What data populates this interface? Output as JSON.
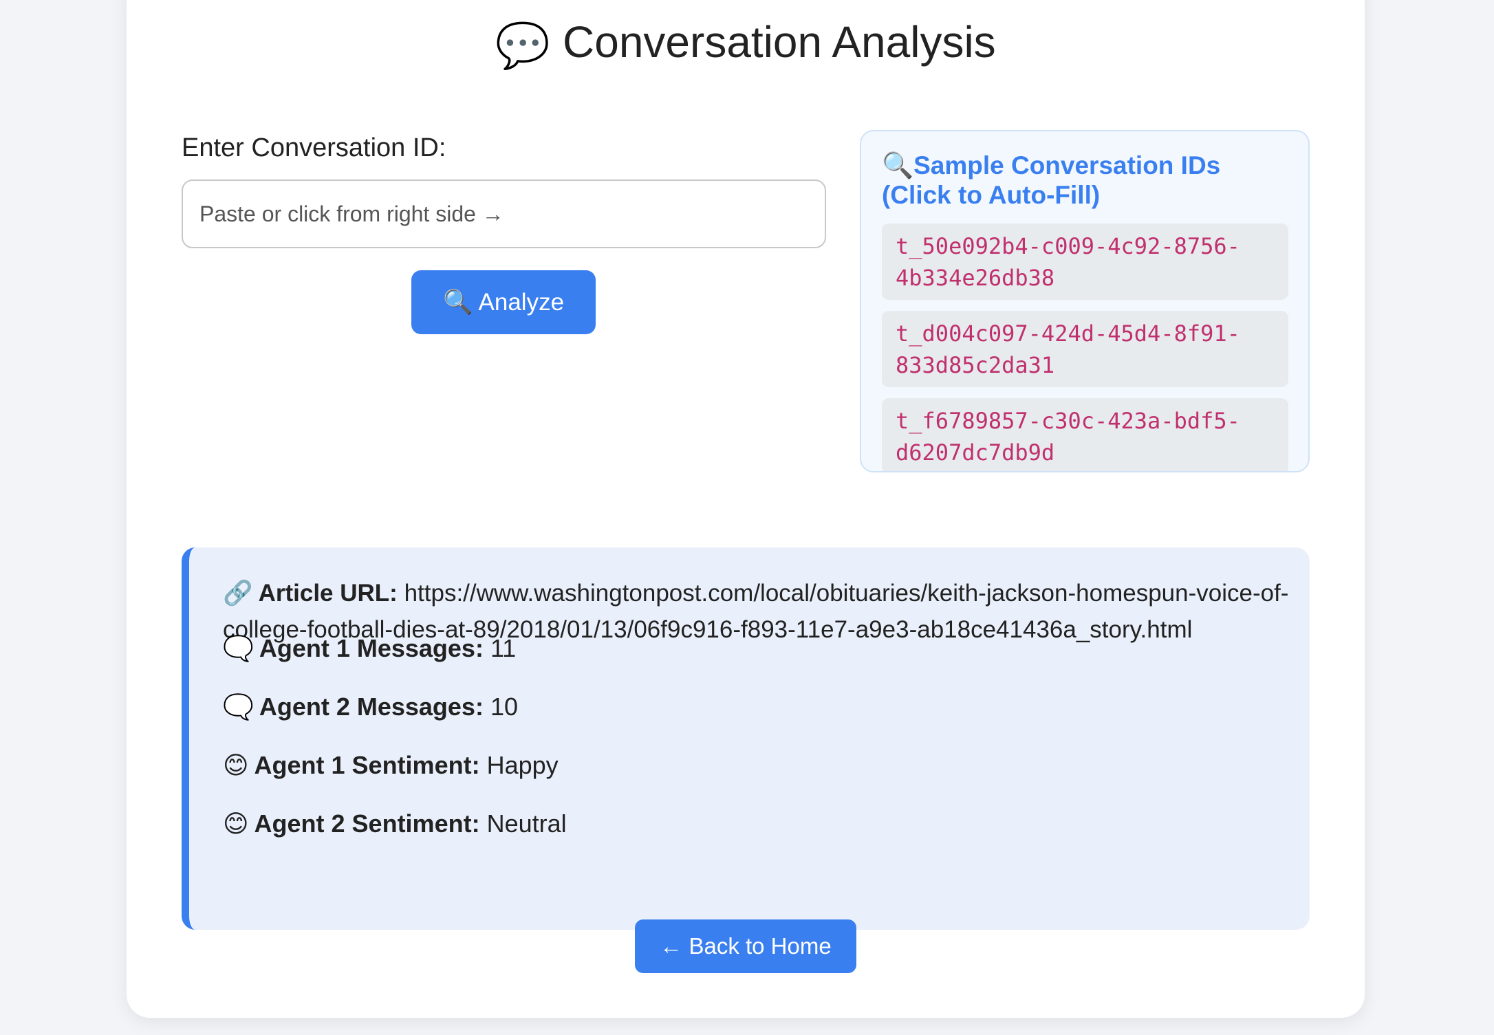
{
  "header": {
    "title_icon": "💬",
    "title": "Conversation Analysis"
  },
  "form": {
    "label": "Enter Conversation ID:",
    "input_value": "",
    "input_placeholder": "Paste or click from right side →",
    "analyze_icon": "🔍",
    "analyze_label": "Analyze"
  },
  "samples": {
    "title_icon": "🔍",
    "title": "Sample Conversation IDs (Click to Auto-Fill)",
    "items": [
      {
        "line1": "t_50e092b4-c009-4c92-8756-",
        "line2": "4b334e26db38"
      },
      {
        "line1": "t_d004c097-424d-45d4-8f91-",
        "line2": "833d85c2da31"
      },
      {
        "line1": "t_f6789857-c30c-423a-bdf5-",
        "line2": "d6207dc7db9d"
      }
    ]
  },
  "result": {
    "url_icon": "🔗",
    "url_label": "Article URL:",
    "url_value": "https://www.washingtonpost.com/local/obituaries/keith-jackson-homespun-voice-of-college-football-dies-at-89/2018/01/13/06f9c916-f893-11e7-a9e3-ab18ce41436a_story.html",
    "agent1_messages_icon": "🗨️",
    "agent1_messages_label": "Agent 1 Messages:",
    "agent1_messages_value": "11",
    "agent2_messages_icon": "🗨️",
    "agent2_messages_label": "Agent 2 Messages:",
    "agent2_messages_value": "10",
    "agent1_sentiment_icon": "😊",
    "agent1_sentiment_label": "Agent 1 Sentiment:",
    "agent1_sentiment_value": "Happy",
    "agent2_sentiment_icon": "😊",
    "agent2_sentiment_label": "Agent 2 Sentiment:",
    "agent2_sentiment_value": "Neutral"
  },
  "footer": {
    "back_label": "← Back to Home"
  },
  "colors": {
    "accent": "#3a7ff0",
    "id_text": "#c0306e",
    "result_bg": "#eaf0fb",
    "page_bg": "#f2f4f8"
  }
}
